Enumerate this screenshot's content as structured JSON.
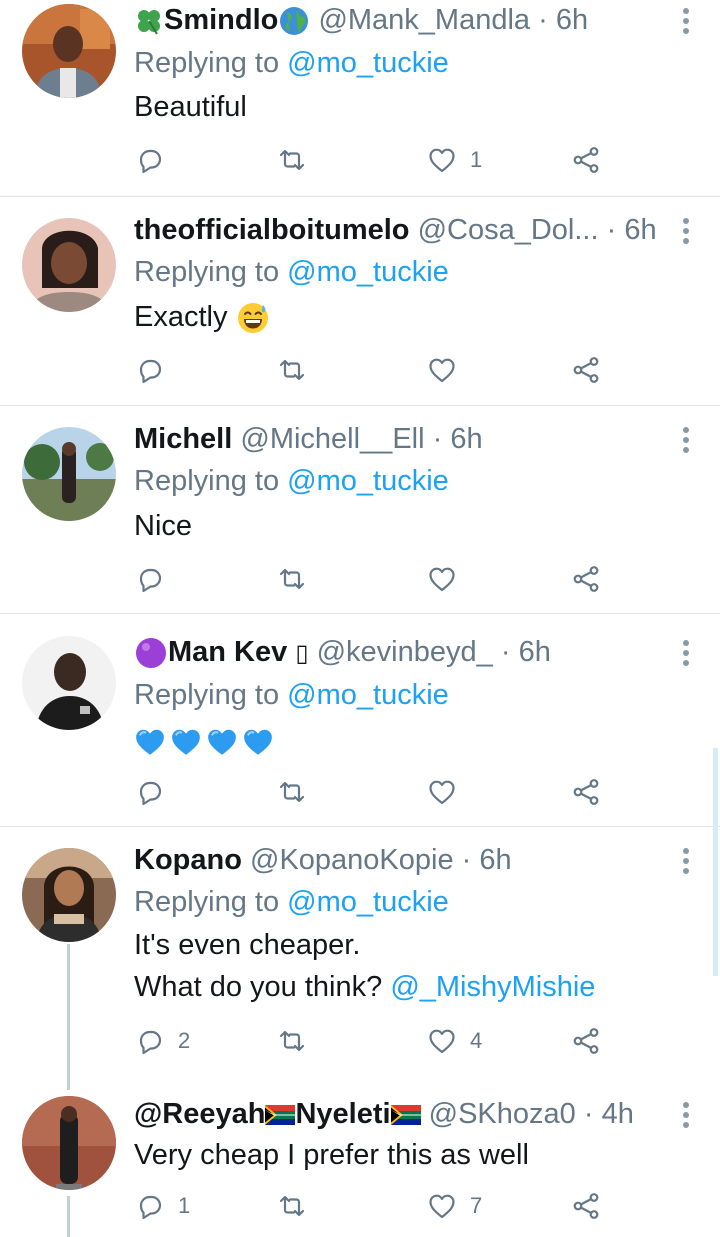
{
  "reply_prefix": "Replying to",
  "colors": {
    "accent": "#1da1f2",
    "secondary_text": "#657786",
    "divider": "#dfe3e6",
    "icon": "#657786"
  },
  "tweets": [
    {
      "name": "Smindlo",
      "name_prefix_emoji": "four-leaf-clover",
      "name_suffix_emoji": "globe",
      "handle": "@Mank_Mandla",
      "time": "6h",
      "replying_to": "@mo_tuckie",
      "text": "Beautiful",
      "replies": "",
      "retweets": "",
      "likes": "1"
    },
    {
      "name": "theofficialboitumelo",
      "handle": "@Cosa_Dol...",
      "time": "6h",
      "replying_to": "@mo_tuckie",
      "text": "Exactly",
      "text_emoji": "grinning-sweat",
      "replies": "",
      "retweets": "",
      "likes": ""
    },
    {
      "name": "Michell",
      "handle": "@Michell__Ell",
      "time": "6h",
      "replying_to": "@mo_tuckie",
      "text": "Nice",
      "replies": "",
      "retweets": "",
      "likes": ""
    },
    {
      "name": "Man Kev",
      "name_prefix_emoji": "purple-circle",
      "name_suffix_glyph": "▯",
      "handle": "@kevinbeyd_",
      "time": "6h",
      "replying_to": "@mo_tuckie",
      "text_emoji": "blue-heart x4",
      "replies": "",
      "retweets": "",
      "likes": ""
    },
    {
      "name": "Kopano",
      "handle": "@KopanoKopie",
      "time": "6h",
      "replying_to": "@mo_tuckie",
      "text_line1": "It's even cheaper.",
      "text_line2": "What do you think?",
      "text_mention": "@_MishyMishie",
      "replies": "2",
      "retweets": "",
      "likes": "4"
    },
    {
      "name_part1": "@Reeyah",
      "name_part2": "Nyeleti",
      "name_flag_emoji": "south-africa-flag",
      "handle": "@SKhoza0",
      "time": "4h",
      "text": "Very cheap I prefer this as well",
      "replies": "1",
      "retweets": "",
      "likes": "7"
    }
  ],
  "separator": "·"
}
